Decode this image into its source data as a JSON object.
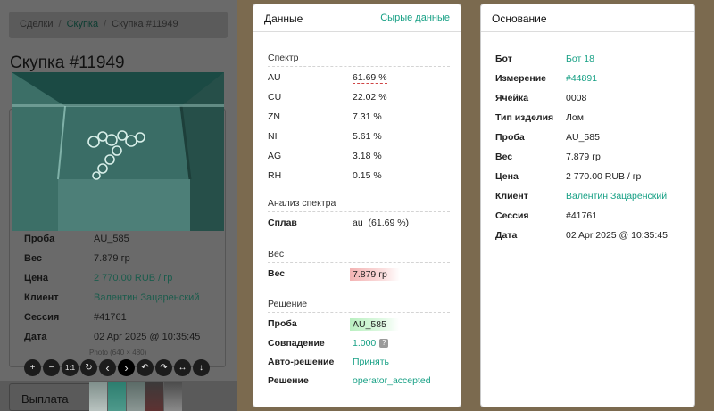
{
  "left": {
    "breadcrumb": {
      "deals": "Сделки",
      "purchases": "Скупка",
      "current": "Скупка #11949",
      "separator": "/"
    },
    "title": "Скупка #11949",
    "photo_caption": "Photo (640 × 480)",
    "rows": [
      {
        "label": "Проба",
        "value": "AU_585",
        "link": false
      },
      {
        "label": "Вес",
        "value": "7.879 гр",
        "link": false
      },
      {
        "label": "Цена",
        "value": "2 770.00 RUB / гр",
        "link": true
      },
      {
        "label": "Клиент",
        "value": "Валентин Зацаренский",
        "link": true
      },
      {
        "label": "Сессия",
        "value": "#41761",
        "link": false
      },
      {
        "label": "Дата",
        "value": "02 Apr 2025 @ 10:35:45",
        "link": false
      }
    ],
    "toolbar": [
      {
        "name": "zoom-in-button",
        "glyph": "+"
      },
      {
        "name": "zoom-out-button",
        "glyph": "−"
      },
      {
        "name": "one-to-one-button",
        "glyph": "1:1"
      },
      {
        "name": "reset-button",
        "glyph": "↻"
      },
      {
        "name": "prev-button",
        "glyph": "‹"
      },
      {
        "name": "next-button",
        "glyph": "›"
      },
      {
        "name": "rotate-left-button",
        "glyph": "↶"
      },
      {
        "name": "rotate-right-button",
        "glyph": "↷"
      },
      {
        "name": "flip-horizontal-button",
        "glyph": "↔"
      },
      {
        "name": "flip-vertical-button",
        "glyph": "↕"
      }
    ],
    "payout_label": "Выплата"
  },
  "data_card": {
    "title": "Данные",
    "raw_link": "Сырые данные",
    "spectrum_title": "Спектр",
    "spectrum": [
      {
        "label": "AU",
        "value": "61.69 %"
      },
      {
        "label": "CU",
        "value": "22.02 %"
      },
      {
        "label": "ZN",
        "value": "7.31 %"
      },
      {
        "label": "NI",
        "value": "5.61 %"
      },
      {
        "label": "AG",
        "value": "3.18 %"
      },
      {
        "label": "RH",
        "value": "0.15 %"
      }
    ],
    "analysis_title": "Анализ спектра",
    "alloy_label": "Сплав",
    "alloy_value": "au",
    "alloy_percent": "(61.69 %)",
    "weight_title": "Вес",
    "weight_label": "Вес",
    "weight_value": "7.879 гр",
    "decision_title": "Решение",
    "decision_rows": {
      "probe_label": "Проба",
      "probe_value": "AU_585",
      "match_label": "Совпадение",
      "match_value": "1.000",
      "match_badge": "?",
      "auto_label": "Авто-решение",
      "auto_value": "Принять",
      "decision_label": "Решение",
      "decision_value": "operator_accepted"
    }
  },
  "base_card": {
    "title": "Основание",
    "rows": [
      {
        "label": "Бот",
        "value": "Бот 18",
        "link": true
      },
      {
        "label": "Измерение",
        "value": "#44891",
        "link": true
      },
      {
        "label": "Ячейка",
        "value": "0008",
        "link": false
      },
      {
        "label": "Тип изделия",
        "value": "Лом",
        "link": false
      },
      {
        "label": "Проба",
        "value": "AU_585",
        "link": false
      },
      {
        "label": "Вес",
        "value": "7.879 гр",
        "link": false
      },
      {
        "label": "Цена",
        "value": "2 770.00 RUB / гр",
        "link": false
      },
      {
        "label": "Клиент",
        "value": "Валентин Зацаренский",
        "link": true
      },
      {
        "label": "Сессия",
        "value": "#41761",
        "link": false
      },
      {
        "label": "Дата",
        "value": "02 Apr 2025 @ 10:35:45",
        "link": false
      }
    ]
  },
  "colors": {
    "accent": "#17a085",
    "danger_highlight": "#f3b3b3",
    "success_highlight": "#b9efc0"
  }
}
